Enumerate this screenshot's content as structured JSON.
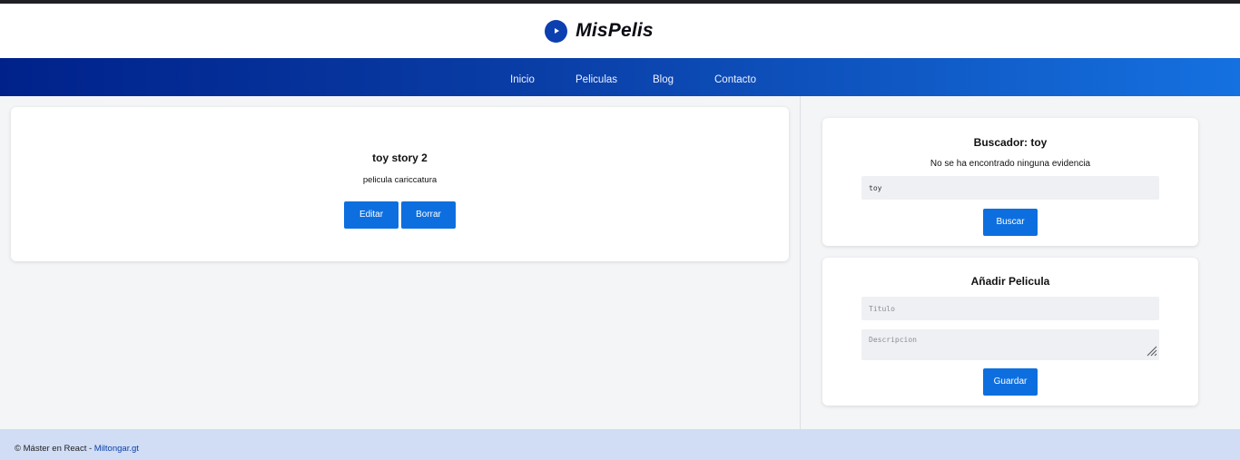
{
  "header": {
    "logo_text": "MisPelis",
    "logo_icon": "play-circle-icon",
    "brand_color": "#0c3fb0"
  },
  "nav": {
    "items": [
      {
        "label": "Inicio"
      },
      {
        "label": "Peliculas"
      },
      {
        "label": "Blog"
      },
      {
        "label": "Contacto"
      }
    ]
  },
  "movie": {
    "title": "toy story 2",
    "description": "pelicula cariccatura",
    "edit_label": "Editar",
    "delete_label": "Borrar"
  },
  "search": {
    "title": "Buscador: toy",
    "message": "No se ha encontrado ninguna evidencia",
    "value": "toy",
    "button_label": "Buscar"
  },
  "add_movie": {
    "title": "Añadir Pelicula",
    "title_placeholder": "Titulo",
    "description_placeholder": "Descripcion",
    "button_label": "Guardar"
  },
  "footer": {
    "text": "© Máster en React - ",
    "link_text": "Miltongar.gt"
  },
  "colors": {
    "accent": "#0d6fdf",
    "nav_gradient_start": "#00218a",
    "nav_gradient_end": "#1571e0",
    "footer_bg": "#d0ddf5"
  }
}
